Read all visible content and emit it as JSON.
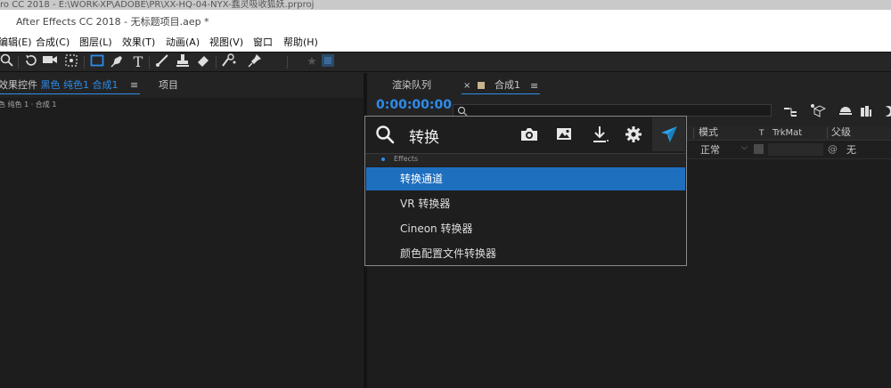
{
  "outer_title": "ro CC 2018 - E:\\WORK-XP\\ADOBE\\PR\\XX-HQ-04-NYX-蠢灵吸收狐妖.prproj",
  "app_title": "After Effects CC 2018 - 无标题项目.aep *",
  "menu": [
    "编辑(E)",
    "合成(C)",
    "图层(L)",
    "效果(T)",
    "动画(A)",
    "视图(V)",
    "窗口",
    "帮助(H)"
  ],
  "left_panel": {
    "tab_prefix": "效果控件",
    "tab_active": "黑色 纯色1 合成1",
    "tab_menu": "≡",
    "tab_project": "项目",
    "breadcrumb": "色 纯色 1 · 合成 1"
  },
  "right_panel": {
    "tab_render": "渲染队列",
    "tab_close": "×",
    "tab_comp": "合成1",
    "tab_menu": "≡",
    "timecode": "0:00:00:00",
    "columns": {
      "mode": "模式",
      "t": "T",
      "trkmat": "TrkMat",
      "parent": "父级"
    },
    "row": {
      "mode_value": "正常",
      "parent_value": "无"
    }
  },
  "popup": {
    "search_text": "转换",
    "category": "Effects",
    "results": [
      "转换通道",
      "VR 转换器",
      "Cineon 转换器",
      "颜色配置文件转换器"
    ],
    "selected_index": 0,
    "accent": "#1f6fbf"
  },
  "colors": {
    "timecode": "#2d8ceb",
    "selection": "#1f6fbf"
  }
}
